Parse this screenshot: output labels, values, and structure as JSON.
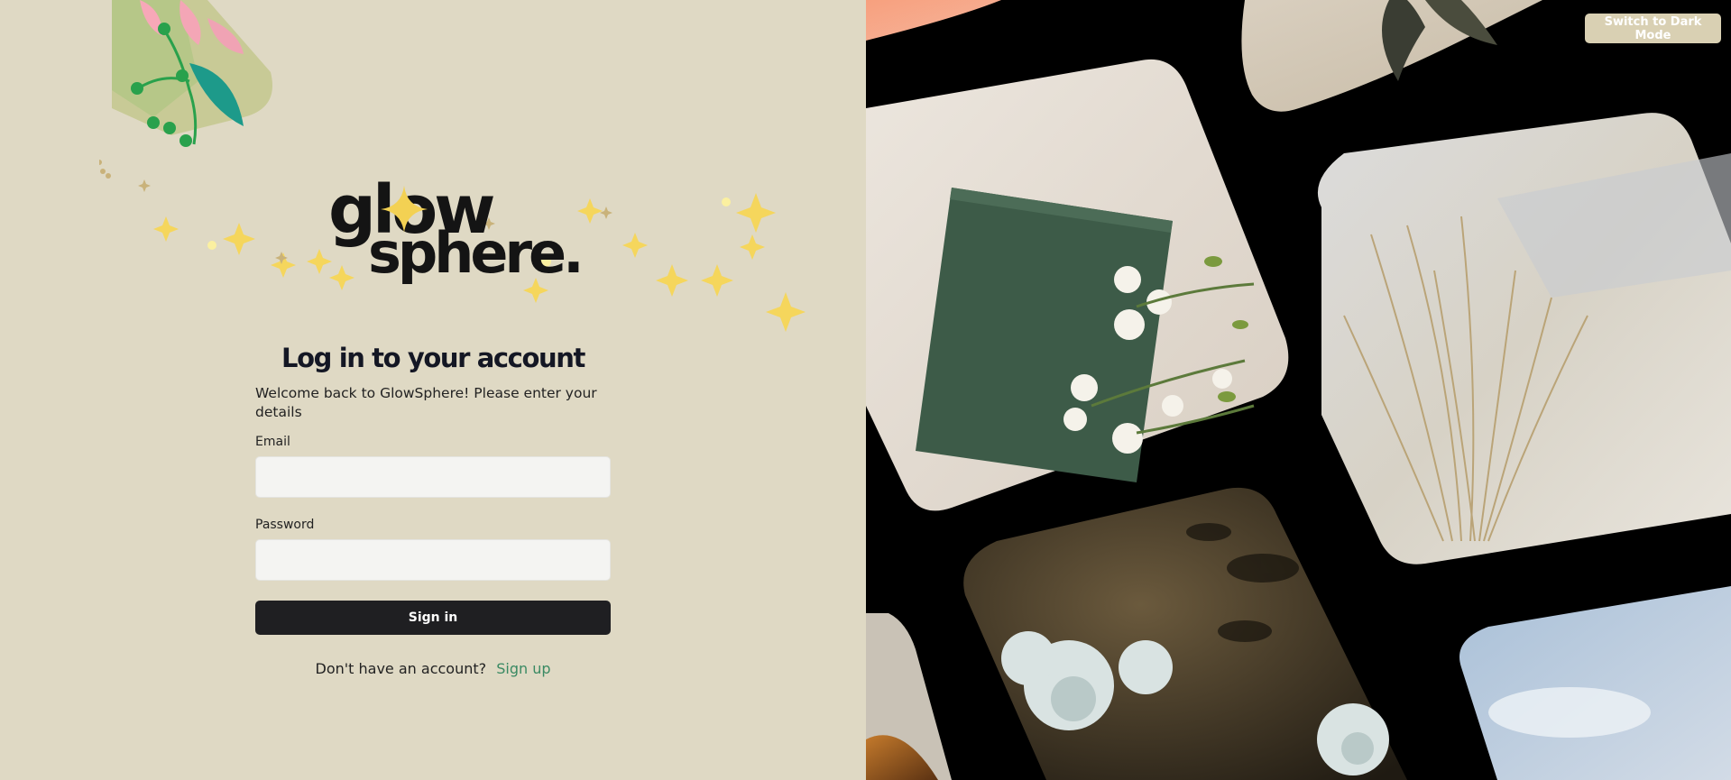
{
  "logo": {
    "line1": "glow",
    "line2": "sphere."
  },
  "login": {
    "title": "Log in to your account",
    "subtitle": "Welcome back to GlowSphere! Please enter your details",
    "email_label": "Email",
    "email_value": "",
    "password_label": "Password",
    "password_value": "",
    "signin_label": "Sign in",
    "signup_prompt": "Don't have an account?",
    "signup_link": "Sign up"
  },
  "theme_toggle": {
    "label": "Switch to Dark Mode"
  },
  "colors": {
    "page_background": "#dfd9c4",
    "gallery_background": "#000000",
    "button_dark": "#1f1f22",
    "link_green": "#3a8a63",
    "toggle_background": "#d9d0b3"
  },
  "icons": [
    "leaf-decoration-icon",
    "sparkle-icon",
    "star-icon"
  ],
  "gallery": {
    "photos": [
      "peach-photo",
      "dried-palm-photo",
      "green-book-flowers-photo",
      "beach-grass-photo",
      "white-roses-photo",
      "autumn-leaves-photo",
      "sky-photo"
    ]
  }
}
